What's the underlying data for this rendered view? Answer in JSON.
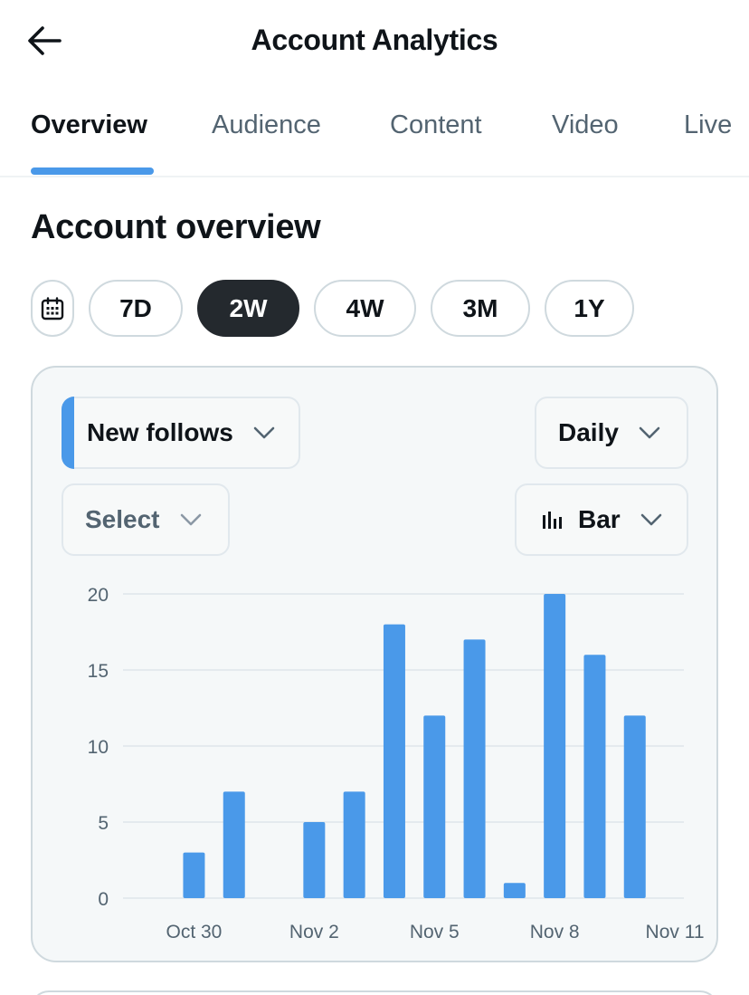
{
  "header": {
    "title": "Account Analytics",
    "back_icon": "arrow-left-icon"
  },
  "tabs": [
    {
      "label": "Overview",
      "active": true
    },
    {
      "label": "Audience",
      "active": false
    },
    {
      "label": "Content",
      "active": false
    },
    {
      "label": "Video",
      "active": false
    },
    {
      "label": "Live",
      "active": false
    }
  ],
  "section": {
    "title": "Account overview"
  },
  "ranges": {
    "calendar_icon": "calendar-icon",
    "options": [
      {
        "label": "7D",
        "selected": false
      },
      {
        "label": "2W",
        "selected": true
      },
      {
        "label": "4W",
        "selected": false
      },
      {
        "label": "3M",
        "selected": false
      },
      {
        "label": "1Y",
        "selected": false
      }
    ]
  },
  "controls": {
    "metric": "New follows",
    "interval": "Daily",
    "compare": "Select",
    "chart_type": "Bar"
  },
  "colors": {
    "accent": "#4a99e9",
    "bar": "#4a99e9",
    "active_pill": "#24292e",
    "grid": "#dfe6ea",
    "axis_text": "#536471"
  },
  "chart_data": {
    "type": "bar",
    "categories": [
      "Oct 29",
      "Oct 30",
      "Oct 31",
      "Nov 1",
      "Nov 2",
      "Nov 3",
      "Nov 4",
      "Nov 5",
      "Nov 6",
      "Nov 7",
      "Nov 8",
      "Nov 9",
      "Nov 10",
      "Nov 11"
    ],
    "values": [
      0,
      3,
      7,
      0,
      5,
      7,
      18,
      12,
      17,
      1,
      20,
      16,
      12,
      null
    ],
    "x_tick_labels": [
      "Oct 30",
      "Nov 2",
      "Nov 5",
      "Nov 8",
      "Nov 11"
    ],
    "y_ticks": [
      0,
      5,
      10,
      15,
      20
    ],
    "ylim": [
      0,
      20
    ],
    "grid": true,
    "title": "",
    "xlabel": "",
    "ylabel": ""
  }
}
